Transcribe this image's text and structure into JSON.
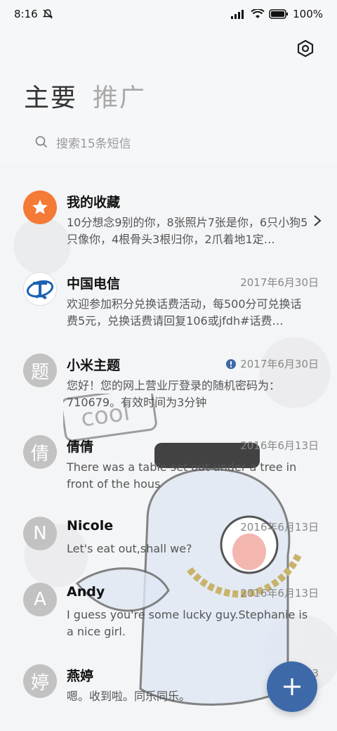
{
  "status": {
    "time": "8:16",
    "battery": "100%"
  },
  "tabs": [
    {
      "label": "主要"
    },
    {
      "label": "推广"
    }
  ],
  "search": {
    "placeholder": "搜索15条短信"
  },
  "conversations": [
    {
      "name": "我的收藏",
      "date": "",
      "preview": "10分想念9别的你，8张照片7张是你，6只小狗5只像你，4根骨头3根归你，2爪着地1定…",
      "avatar": "star-icon"
    },
    {
      "name": "中国电信",
      "date": "2017年6月30日",
      "preview": "欢迎参加积分兑换话费活动，每500分可兑换话费5元，兑换话费请回复106或jfdh#话费…",
      "avatar": "china-telecom-logo"
    },
    {
      "name": "小米主题",
      "date": "2017年6月30日",
      "preview": "您好！您的网上营业厅登录的随机密码为：710679。有效时间为3分钟",
      "avatar": "题"
    },
    {
      "name": "倩倩",
      "date": "2016年6月13日",
      "preview": "There was a table set out under a tree in front of the hous",
      "avatar": "倩"
    },
    {
      "name": "Nicole",
      "date": "2016年6月13日",
      "preview": "Let's eat out,shall we?",
      "avatar": "N"
    },
    {
      "name": "Andy",
      "date": "2016年6月13日",
      "preview": "I guess you're some lucky guy.Stephanie is a nice girl.",
      "avatar": "A"
    },
    {
      "name": "燕婷",
      "date": "2013",
      "preview": "嗯。收到啦。同乐同乐。",
      "avatar": "婷"
    }
  ],
  "colors": {
    "accent": "#3d69a8",
    "favorite": "#f47a36",
    "avatar_gray": "#c2c2c2",
    "alert": "#3d69a8"
  }
}
